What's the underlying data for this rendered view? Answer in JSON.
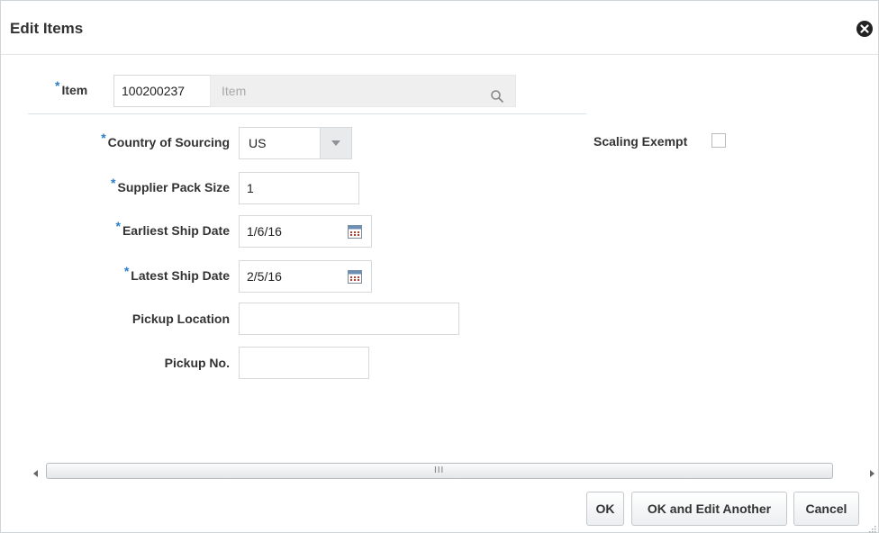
{
  "dialog": {
    "title": "Edit Items",
    "close_icon": "close-icon"
  },
  "form": {
    "required_marker": "*",
    "item": {
      "label": "Item",
      "value": "100200237",
      "description_placeholder": "Item",
      "search_icon": "search-icon"
    },
    "country_of_sourcing": {
      "label": "Country of Sourcing",
      "value": "US",
      "dropdown_icon": "chevron-down-icon"
    },
    "supplier_pack_size": {
      "label": "Supplier Pack Size",
      "value": "1"
    },
    "earliest_ship_date": {
      "label": "Earliest Ship Date",
      "value": "1/6/16",
      "calendar_icon": "calendar-icon"
    },
    "latest_ship_date": {
      "label": "Latest Ship Date",
      "value": "2/5/16",
      "calendar_icon": "calendar-icon"
    },
    "pickup_location": {
      "label": "Pickup Location",
      "value": ""
    },
    "pickup_no": {
      "label": "Pickup No.",
      "value": ""
    },
    "scaling_exempt": {
      "label": "Scaling Exempt",
      "checked": false
    }
  },
  "scrollbar": {
    "grip": "III"
  },
  "buttons": {
    "ok": "OK",
    "ok_and_edit_another": "OK and Edit Another",
    "cancel": "Cancel"
  },
  "colors": {
    "required_marker": "#2c7fc8",
    "separator": "#d7e1ea",
    "calendar_accent": "#c0392b"
  }
}
